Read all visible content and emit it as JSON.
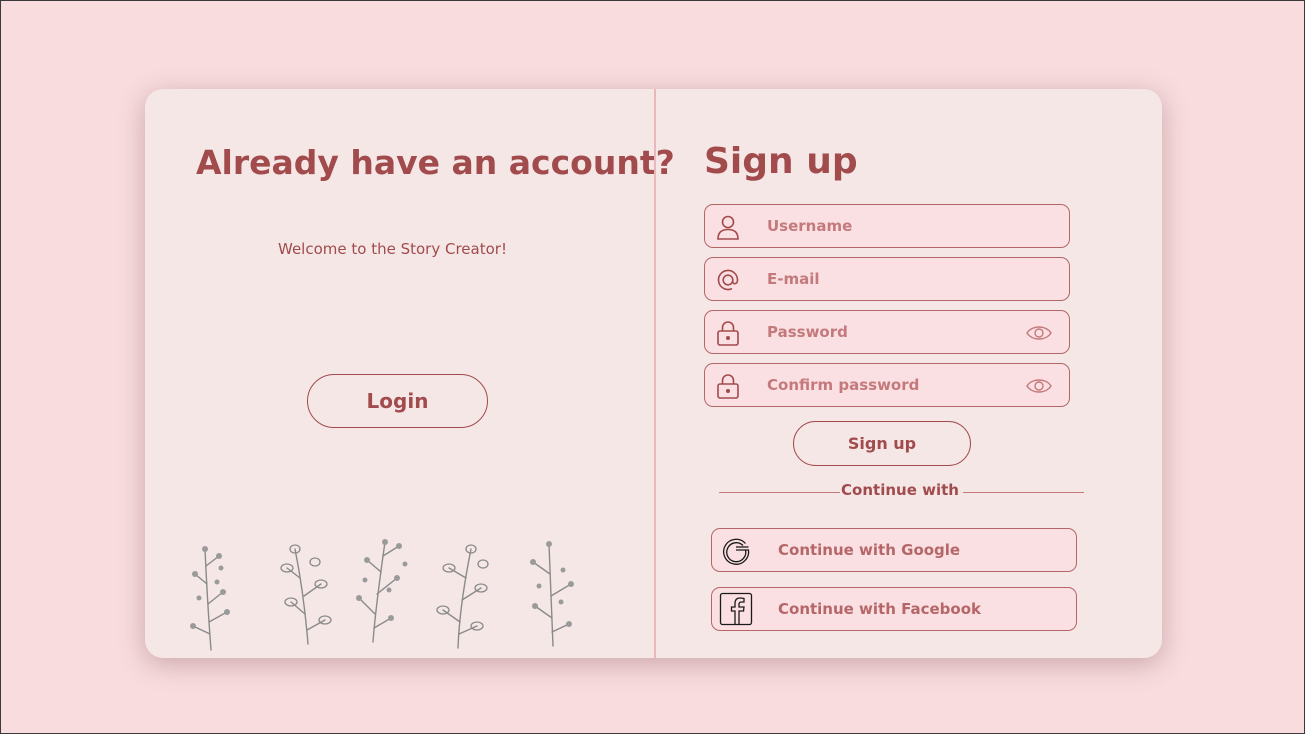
{
  "left": {
    "title": "Already have an account?",
    "welcome": "Welcome to the Story Creator!",
    "login_label": "Login"
  },
  "signup": {
    "title": "Sign up",
    "fields": {
      "username": {
        "placeholder": "Username",
        "icon": "user-icon"
      },
      "email": {
        "placeholder": "E-mail",
        "icon": "at-sign-icon"
      },
      "password": {
        "placeholder": "Password",
        "icon": "lock-icon"
      },
      "confirm_password": {
        "placeholder": "Confirm password",
        "icon": "lock-icon"
      }
    },
    "submit_label": "Sign up",
    "continue_with": "Continue with",
    "google_label": "Continue with Google",
    "facebook_label": "Continue with Facebook"
  },
  "colors": {
    "page_bg": "#f8dcde",
    "card_bg": "#f6e7e7",
    "accent": "#a14b4d",
    "field_bg": "#fae0e2",
    "divider": "#eab8bb"
  }
}
